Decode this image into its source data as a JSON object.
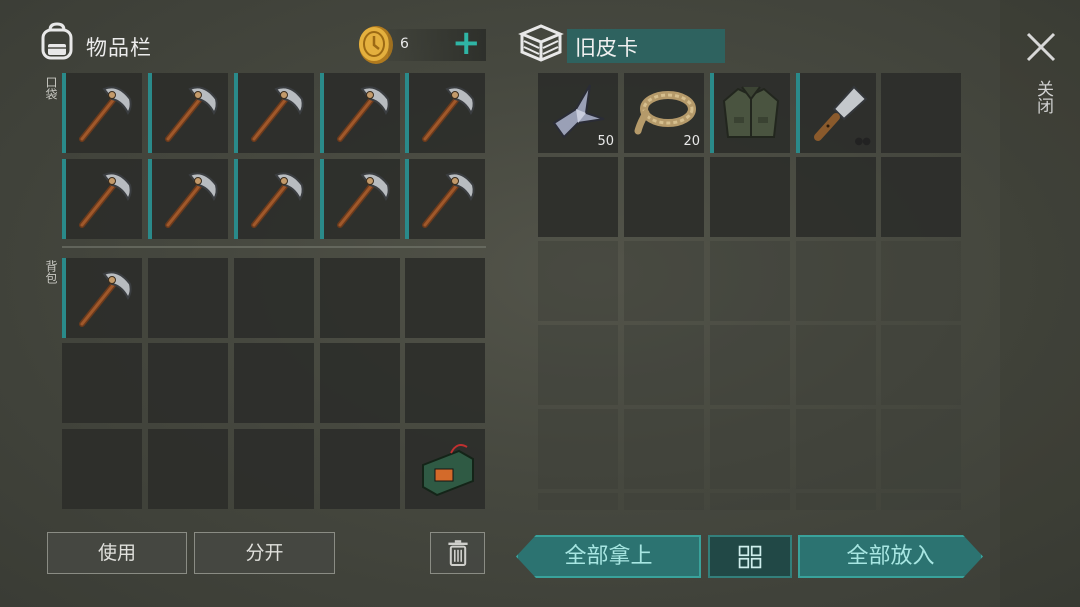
{
  "inventory": {
    "title": "物品栏",
    "coins": "6",
    "pocket_label": "口袋",
    "backpack_label": "背包"
  },
  "container": {
    "name": "旧皮卡",
    "items": [
      {
        "name": "metal-scraps",
        "qty": "50"
      },
      {
        "name": "rope",
        "qty": "20"
      },
      {
        "name": "jacket",
        "qty": ""
      },
      {
        "name": "cleaver",
        "qty": ""
      }
    ]
  },
  "close": {
    "label": "关闭"
  },
  "buttons": {
    "use": "使用",
    "split": "分开",
    "take_all": "全部拿上",
    "put_all": "全部放入"
  },
  "colors": {
    "accent": "#2fb5a5",
    "slot_bar": "#2a8a8a",
    "name_bg": "#2e625f"
  }
}
